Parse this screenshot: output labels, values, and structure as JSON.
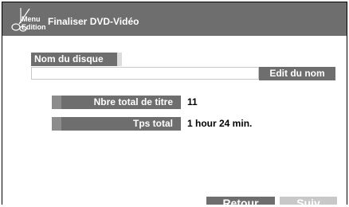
{
  "header": {
    "menu_line1": "Menu",
    "menu_line2": "Edition",
    "title": "Finaliser DVD-Vidéo",
    "icon": "scissors-icon"
  },
  "disc": {
    "label": "Nom du disque",
    "value": "",
    "edit_button": "Edit du nom"
  },
  "info": {
    "total_titles_label": "Nbre total de titre",
    "total_titles_value": "11",
    "total_time_label": "Tps total",
    "total_time_value": "1 hour 24 min."
  },
  "footer": {
    "back_label": "Retour",
    "next_label": "Suiv"
  },
  "colors": {
    "header_bg": "#6e6e6e",
    "label_bg": "#6e6e6e",
    "disabled_button": "#c8c8c8"
  }
}
